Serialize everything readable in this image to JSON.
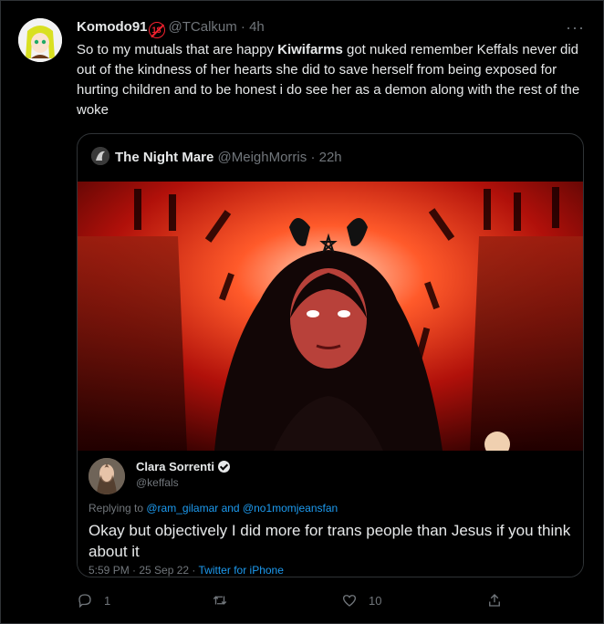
{
  "tweet": {
    "author_name": "Komodo91",
    "author_handle": "@TCalkum",
    "time": "· 4h",
    "badge": "18",
    "more": "···",
    "text_pre": "So to my mutuals that are happy ",
    "text_bold": "Kiwifarms",
    "text_post": " got nuked remember Keffals never did out of the kindness of her hearts she did to save herself from being exposed for hurting children and to be honest i do see her as a demon along with the rest of the woke"
  },
  "quote": {
    "author_name": "The Night Mare",
    "author_handle": "@MeighMorris",
    "time": "· 22h",
    "inner": {
      "name": "Clara Sorrenti",
      "handle": "@keffals",
      "replying_prefix": "Replying to ",
      "replying_users": "@ram_gilamar and @no1momjeansfan",
      "text": "Okay but objectively I did more for trans people than Jesus if you think about it",
      "meta_time": "5:59 PM · 25 Sep 22 · ",
      "meta_client": "Twitter for iPhone"
    }
  },
  "actions": {
    "reply_count": "1",
    "retweet_count": "",
    "like_count": "10"
  },
  "colors": {
    "background": "#000000",
    "text": "#e7e9ea",
    "muted": "#71767b",
    "link": "#1d9bf0",
    "badge_red": "#f4212e"
  }
}
